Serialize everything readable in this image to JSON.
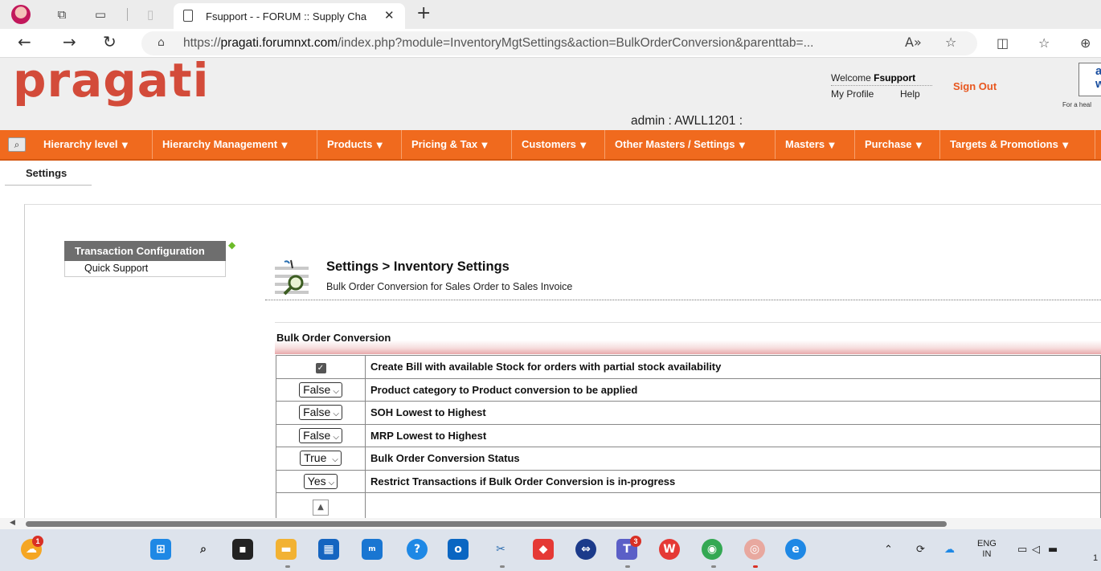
{
  "browser": {
    "tab_title": "Fsupport - - FORUM :: Supply Cha",
    "url_prefix": "https://",
    "url_domain": "pragati.forumnxt.com",
    "url_rest": "/index.php?module=InventoryMgtSettings&action=BulkOrderConversion&parenttab=..."
  },
  "header": {
    "logo": "pragati",
    "welcome_label": "Welcome",
    "user": "Fsupport",
    "my_profile": "My Profile",
    "help": "Help",
    "sign_out": "Sign Out",
    "brand_letters": "a\nw",
    "tagline": "For a heal",
    "admin_info": "admin : AWLL1201 :"
  },
  "menu": {
    "items": [
      {
        "label": "Hierarchy level"
      },
      {
        "label": "Hierarchy Management"
      },
      {
        "label": "Products"
      },
      {
        "label": "Pricing & Tax"
      },
      {
        "label": "Customers"
      },
      {
        "label": "Other Masters / Settings"
      },
      {
        "label": "Masters"
      },
      {
        "label": "Purchase"
      },
      {
        "label": "Targets & Promotions"
      }
    ]
  },
  "subtab": "Settings",
  "sidebar": {
    "heading": "Transaction Configuration",
    "items": [
      "Quick Support"
    ]
  },
  "page": {
    "title": "Settings > Inventory Settings",
    "subtitle": "Bulk Order Conversion for Sales Order to Sales Invoice",
    "section": "Bulk Order Conversion"
  },
  "settings": [
    {
      "control": "checkbox",
      "value": "checked",
      "label": "Create Bill with available Stock for orders with partial stock availability"
    },
    {
      "control": "select",
      "value": "False",
      "label": "Product category to Product conversion to be applied"
    },
    {
      "control": "select",
      "value": "False",
      "label": "SOH Lowest to Highest"
    },
    {
      "control": "select",
      "value": "False",
      "label": "MRP Lowest to Highest"
    },
    {
      "control": "select",
      "value": "True",
      "label": "Bulk Order Conversion Status"
    },
    {
      "control": "select",
      "value": "Yes",
      "label": "Restrict Transactions if Bulk Order Conversion is in-progress"
    }
  ],
  "taskbar": {
    "lang_line1": "ENG",
    "lang_line2": "IN",
    "teams_badge": "3",
    "weather_badge": "1",
    "clock": "1"
  },
  "colors": {
    "menu_orange": "#f06a1e",
    "logo_red": "#d34b3a",
    "signout_orange": "#e8571f",
    "sidebar_head": "#6e6e6e"
  }
}
